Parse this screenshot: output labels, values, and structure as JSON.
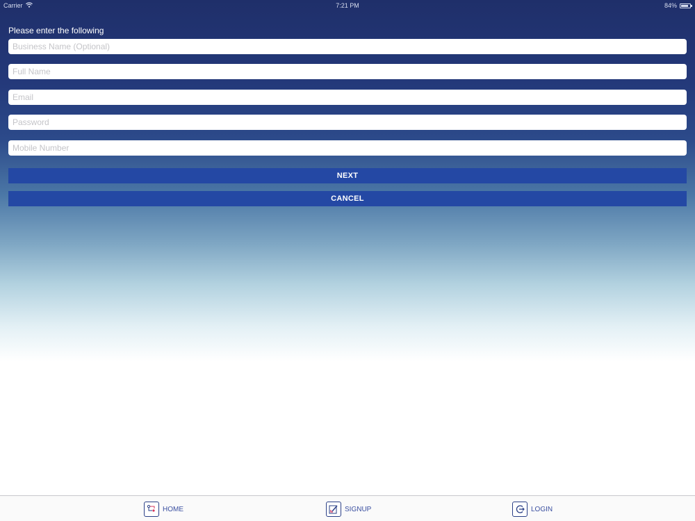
{
  "status_bar": {
    "carrier": "Carrier",
    "time": "7:21 PM",
    "battery": "84%",
    "battery_level": 0.84
  },
  "form": {
    "title": "Please enter the following",
    "fields": [
      {
        "placeholder": "Business Name (Optional)",
        "value": ""
      },
      {
        "placeholder": "Full Name",
        "value": ""
      },
      {
        "placeholder": "Email",
        "value": ""
      },
      {
        "placeholder": "Password",
        "value": ""
      },
      {
        "placeholder": "Mobile Number",
        "value": ""
      }
    ],
    "next_label": "NEXT",
    "cancel_label": "CANCEL"
  },
  "tabbar": {
    "items": [
      {
        "label": "HOME",
        "icon": "home-icon"
      },
      {
        "label": "SIGNUP",
        "icon": "signup-icon"
      },
      {
        "label": "LOGIN",
        "icon": "login-icon"
      }
    ]
  },
  "colors": {
    "button": "#2448a4",
    "tab_label": "#3a4fa0",
    "accent_red": "#d6345a"
  }
}
